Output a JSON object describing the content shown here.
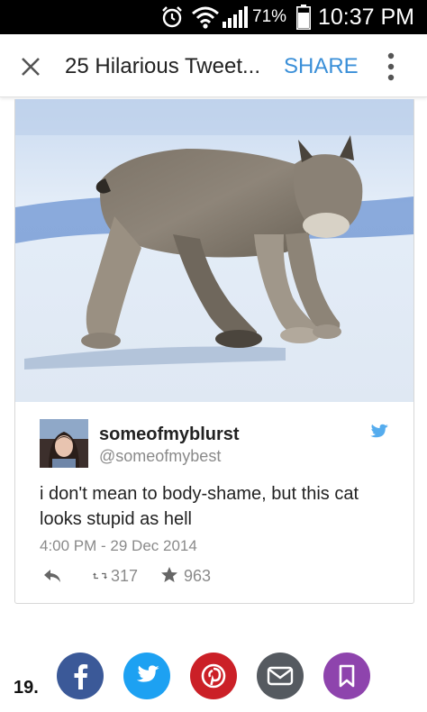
{
  "status_bar": {
    "battery_percent": "71%",
    "time": "10:37 PM",
    "icons": [
      "alarm-icon",
      "wifi-icon",
      "signal-icon",
      "battery-icon"
    ]
  },
  "app_bar": {
    "title": "25 Hilarious Tweet...",
    "share_label": "SHARE",
    "icons": [
      "close-icon",
      "more-vert-icon"
    ]
  },
  "tweet": {
    "display_name": "someofmyblurst",
    "handle": "@someofmybest",
    "text": "i don't mean to body-shame, but this cat looks stupid as hell",
    "timestamp": "4:00 PM - 29 Dec 2014",
    "retweets": "317",
    "likes": "963",
    "icons": [
      "twitter-bird-icon",
      "reply-icon",
      "retweet-icon",
      "star-icon"
    ]
  },
  "share_row": {
    "item_number": "19.",
    "buttons": [
      {
        "name": "facebook",
        "icon": "facebook-icon",
        "color": "#3b5998"
      },
      {
        "name": "twitter",
        "icon": "twitter-icon",
        "color": "#1da1f2"
      },
      {
        "name": "pinterest",
        "icon": "pinterest-icon",
        "color": "#cb2027"
      },
      {
        "name": "email",
        "icon": "email-icon",
        "color": "#555a60"
      },
      {
        "name": "bookmark",
        "icon": "bookmark-icon",
        "color": "#8e44ad"
      }
    ]
  },
  "colors": {
    "accent": "#3a8fd8",
    "twitter_blue": "#55acee",
    "muted_text": "#8a8a8a"
  }
}
